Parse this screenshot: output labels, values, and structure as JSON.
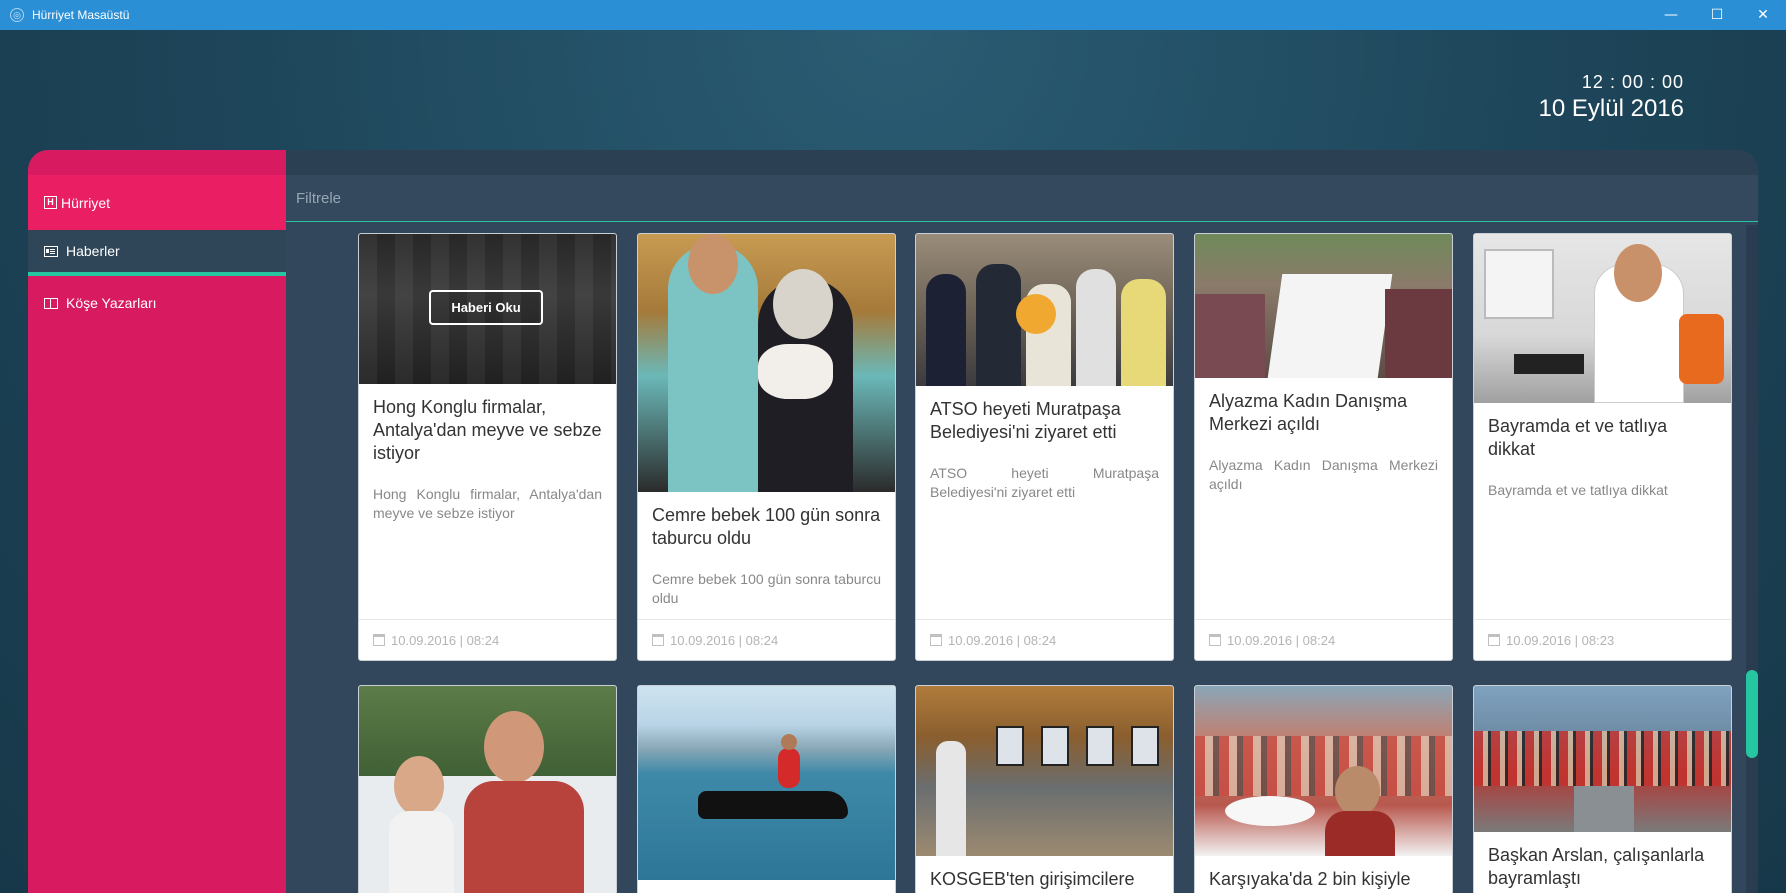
{
  "window": {
    "title": "Hürriyet Masaüstü",
    "controls": [
      "minimize",
      "maximize",
      "close"
    ]
  },
  "clock": {
    "time": "12 : 00 : 00",
    "date": "10 Eylül 2016"
  },
  "sidebar": {
    "brand": "Hürriyet",
    "items": [
      {
        "label": "Haberler",
        "icon": "newspaper-icon",
        "active": true
      },
      {
        "label": "Köşe Yazarları",
        "icon": "book-icon",
        "active": false
      }
    ]
  },
  "filter": {
    "placeholder": "Filtrele",
    "value": ""
  },
  "colors": {
    "accent": "#e91e63",
    "sidebar": "#d81b60",
    "highlight": "#26c6a0",
    "titlebar": "#2b8fd6"
  },
  "cards": [
    {
      "title": "Hong Konglu firmalar, Antalya'dan meyve ve sebze istiyor",
      "summary": "Hong Konglu firmalar, Antalya'dan meyve ve sebze istiyor",
      "date": "10.09.2016 | 08:24",
      "hover_label": "Haberi Oku"
    },
    {
      "title": "Cemre bebek 100 gün sonra taburcu oldu",
      "summary": "Cemre bebek 100 gün sonra taburcu oldu",
      "date": "10.09.2016 | 08:24"
    },
    {
      "title": "ATSO heyeti Muratpaşa Belediyesi'ni ziyaret etti",
      "summary": "ATSO heyeti Muratpaşa Belediyesi'ni ziyaret etti",
      "date": "10.09.2016 | 08:24"
    },
    {
      "title": "Alyazma Kadın Danışma Merkezi açıldı",
      "summary": "Alyazma Kadın Danışma Merkezi açıldı",
      "date": "10.09.2016 | 08:24"
    },
    {
      "title": "Bayramda et ve tatlıya dikkat",
      "summary": "Bayramda et ve tatlıya dikkat",
      "date": "10.09.2016 | 08:23"
    },
    {
      "title": "",
      "summary": "",
      "date": ""
    },
    {
      "title": "",
      "summary": "",
      "date": ""
    },
    {
      "title": "KOSGEB'ten girişimcilere",
      "summary": "",
      "date": ""
    },
    {
      "title": "Karşıyaka'da 2 bin kişiyle",
      "summary": "",
      "date": ""
    },
    {
      "title": "Başkan Arslan, çalışanlarla bayramlaştı",
      "summary": "",
      "date": ""
    }
  ]
}
